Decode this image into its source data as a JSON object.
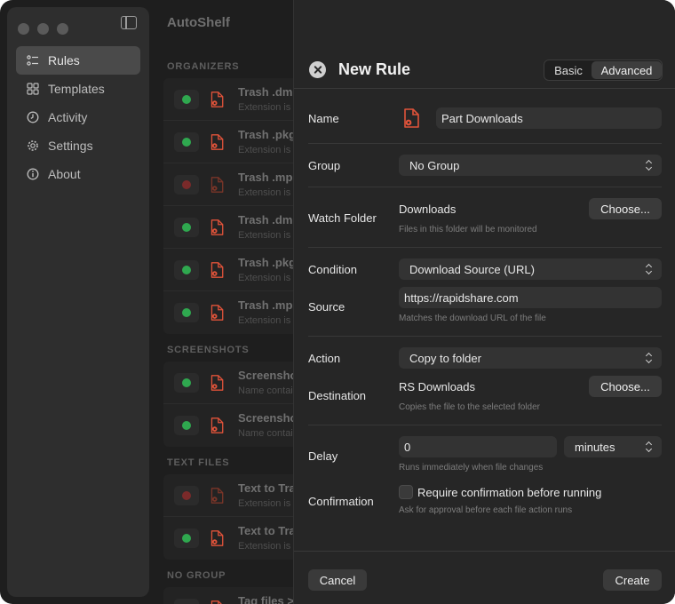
{
  "sidebar": {
    "items": [
      {
        "label": "Rules",
        "icon": "list-icon",
        "active": true
      },
      {
        "label": "Templates",
        "icon": "grid-icon",
        "active": false
      },
      {
        "label": "Activity",
        "icon": "clock-icon",
        "active": false
      },
      {
        "label": "Settings",
        "icon": "gear-icon",
        "active": false
      },
      {
        "label": "About",
        "icon": "info-icon",
        "active": false
      }
    ]
  },
  "main": {
    "title": "AutoShelf",
    "sections": [
      {
        "label": "ORGANIZERS",
        "rows": [
          {
            "title": "Trash .dm",
            "sub": "Extension is .",
            "enabled": true
          },
          {
            "title": "Trash .pkg",
            "sub": "Extension is .",
            "enabled": true
          },
          {
            "title": "Trash .mpl",
            "sub": "Extension is .",
            "enabled": false
          },
          {
            "title": "Trash .dm",
            "sub": "Extension is .",
            "enabled": true
          },
          {
            "title": "Trash .pkg",
            "sub": "Extension is .",
            "enabled": true
          },
          {
            "title": "Trash .mp",
            "sub": "Extension is .",
            "enabled": true
          }
        ]
      },
      {
        "label": "SCREENSHOTS",
        "rows": [
          {
            "title": "Screensho",
            "sub": "Name contai",
            "enabled": true
          },
          {
            "title": "Screensho",
            "sub": "Name contai",
            "enabled": true
          }
        ]
      },
      {
        "label": "TEXT FILES",
        "rows": [
          {
            "title": "Text to Tra",
            "sub": "Extension is .",
            "enabled": false
          },
          {
            "title": "Text to Tra",
            "sub": "Extension is .",
            "enabled": true
          }
        ]
      },
      {
        "label": "NO GROUP",
        "rows": [
          {
            "title": "Tag files >",
            "sub": "",
            "enabled": true
          }
        ]
      }
    ]
  },
  "sheet": {
    "title": "New Rule",
    "tabs": {
      "basic": "Basic",
      "advanced": "Advanced",
      "selected": "Advanced"
    },
    "name": {
      "label": "Name",
      "value": "Part Downloads",
      "icon": "document-gear-icon"
    },
    "group": {
      "label": "Group",
      "value": "No Group"
    },
    "watch_folder": {
      "label": "Watch Folder",
      "value": "Downloads",
      "button": "Choose...",
      "hint": "Files in this folder will be monitored"
    },
    "condition": {
      "label": "Condition",
      "value": "Download Source (URL)"
    },
    "source": {
      "label": "Source",
      "value": "https://rapidshare.com",
      "hint": "Matches the download URL of the file"
    },
    "action": {
      "label": "Action",
      "value": "Copy to folder"
    },
    "destination": {
      "label": "Destination",
      "value": "RS Downloads",
      "button": "Choose...",
      "hint": "Copies the file to the selected folder"
    },
    "delay": {
      "label": "Delay",
      "value": "0",
      "unit": "minutes",
      "hint": "Runs immediately when file changes"
    },
    "confirmation": {
      "label": "Confirmation",
      "checkbox_label": "Require confirmation before running",
      "checked": false,
      "hint": "Ask for approval before each file action runs"
    },
    "footer": {
      "cancel": "Cancel",
      "create": "Create"
    }
  },
  "colors": {
    "enabled_dot": "#2fa84f",
    "disabled_dot": "#7a2a2a",
    "file_icon": "#e0533a"
  }
}
